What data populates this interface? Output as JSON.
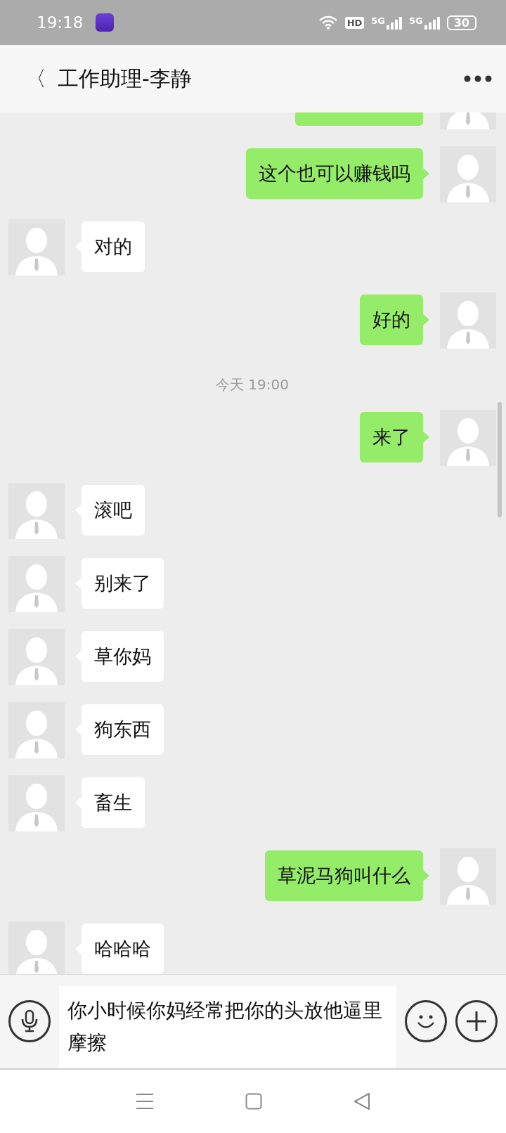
{
  "status_bar": {
    "time": "19:18",
    "network_badge": "HD",
    "signals": [
      {
        "label": "5G"
      },
      {
        "label": "5G"
      }
    ],
    "battery": "30"
  },
  "header": {
    "back": "〈",
    "title": "工作助理-李静"
  },
  "messages": [
    {
      "kind": "sent"
    },
    {
      "kind": "sent",
      "text": "这个也可以赚钱吗"
    },
    {
      "kind": "received",
      "text": "对的"
    },
    {
      "kind": "sent",
      "text": "好的"
    },
    {
      "kind": "time",
      "text": "今天 19:00"
    },
    {
      "kind": "sent",
      "text": "来了"
    },
    {
      "kind": "received",
      "text": "滚吧"
    },
    {
      "kind": "received",
      "text": "别来了"
    },
    {
      "kind": "received",
      "text": "草你妈"
    },
    {
      "kind": "received",
      "text": "狗东西"
    },
    {
      "kind": "received",
      "text": "畜生"
    },
    {
      "kind": "sent",
      "text": "草泥马狗叫什么"
    },
    {
      "kind": "received",
      "text": "哈哈哈"
    }
  ],
  "input": {
    "value": "你小时候你妈经常把你的头放他逼里摩擦"
  }
}
